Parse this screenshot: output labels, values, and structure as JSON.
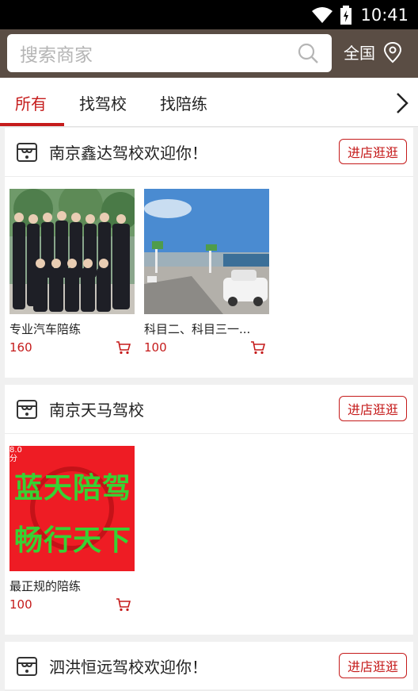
{
  "status_bar": {
    "time": "10:41"
  },
  "search": {
    "placeholder": "搜索商家",
    "region_label": "全国"
  },
  "tabs": [
    {
      "label": "所有",
      "active": true
    },
    {
      "label": "找驾校",
      "active": false
    },
    {
      "label": "找陪练",
      "active": false
    }
  ],
  "shops": [
    {
      "name": "南京鑫达驾校欢迎你！",
      "visit_label": "进店逛逛",
      "products": [
        {
          "name": "专业汽车陪练",
          "price": "160"
        },
        {
          "name": "科目二、科目三一...",
          "price": "100"
        }
      ]
    },
    {
      "name": "南京天马驾校",
      "visit_label": "进店逛逛",
      "products": [
        {
          "name": "最正规的陪练",
          "price": "100",
          "image_text_line1": "蓝天陪驾",
          "image_text_line2": "畅行天下",
          "image_badge": "8.0分"
        }
      ]
    },
    {
      "name": "泗洪恒远驾校欢迎你！",
      "visit_label": "进店逛逛",
      "products": []
    }
  ],
  "colors": {
    "accent": "#c51b1b",
    "header_bg": "#5a4d44"
  }
}
